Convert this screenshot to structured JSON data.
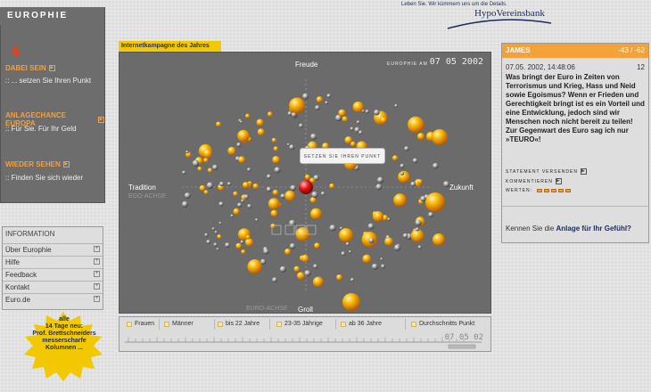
{
  "header": {
    "app_title": "EUROPHIE",
    "bank_slogan": "Leben Sie. Wir kümmern uns um die Details.",
    "bank_name": "HypoVereinsbank"
  },
  "nav": {
    "items": [
      {
        "label": "DABEI SEIN",
        "sub": ":: ... setzen Sie Ihren Punkt"
      },
      {
        "label": "ANLAGECHANCE EUROPA",
        "sub": ":: Für Sie. Für Ihr Geld"
      },
      {
        "label": "WIEDER SEHEN",
        "sub": ":: Finden Sie sich wieder"
      }
    ]
  },
  "info": {
    "title": "INFORMATION",
    "items": [
      "Über Europhie",
      "Hilfe",
      "Feedback",
      "Kontakt",
      "Euro.de"
    ]
  },
  "badge": {
    "lines": [
      "alle",
      "14 Tage neu:",
      "Prof. Brettschneiders",
      "messerscharfe",
      "Kolumnen ..."
    ]
  },
  "viz": {
    "tab_label": "Internetkampagne des Jahres",
    "brand": "EUROPHIE AM",
    "date": "07 05 2002",
    "top_label": "Freude",
    "bottom_label": "Groll",
    "bottom_sub": "EURO-ACHSE",
    "left_label": "Tradition",
    "left_sub": "EGO-ACHSE",
    "right_label": "Zukunft",
    "tooltip": "SETZEN SIE IHREN PUNKT"
  },
  "filters": {
    "items": [
      "Frauen",
      "Männer",
      "bis 22 Jahre",
      "23-35 Jährige",
      "ab 36 Jahre",
      "Durchschnitts Punkt"
    ],
    "time_readout": "07 05 02"
  },
  "statement": {
    "author": "JAMES",
    "counter": "-43 / -62",
    "timestamp": "07.05. 2002, 14:48:06",
    "number": "12",
    "quote": "Was bringt der Euro in Zeiten von Terrorismus und Krieg, Hass und Neid sowie Egoismus? Wenn er Frieden und Gerechtigkeit bringt ist es ein Vorteil und eine Entwicklung, jedoch sind wir Menschen noch nicht bereit zu teilen! Zur Gegenwart des Euro sag ich nur »TEURO«!",
    "send_label": "STATEMENT VERSENDEN",
    "comment_label": "KOMMENTIEREN",
    "rating_label": "WERTEN:",
    "footer_text": "Kennen Sie die",
    "footer_link": "Anlage für Ihr Gefühl?"
  },
  "colors": {
    "orange": "#f3a23a",
    "viz_bg": "#6b6b6b",
    "panel_gray": "#6d6d6d",
    "brand_blue": "#1c2a5e"
  }
}
